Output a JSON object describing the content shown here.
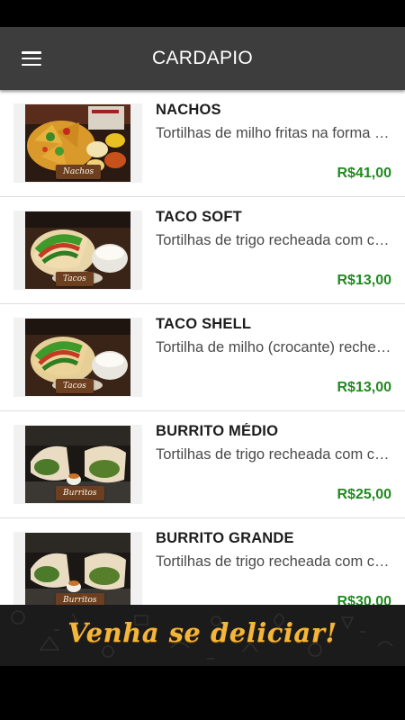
{
  "app_bar": {
    "title": "CARDAPIO",
    "menu_icon": "hamburger-menu-icon"
  },
  "colors": {
    "app_bar": "#3d3d3d",
    "price": "#1f8a1f",
    "banner_bg": "#1b1b1b",
    "banner_text": "#f4b63a"
  },
  "menu": {
    "items": [
      {
        "name": "NACHOS",
        "description": "Tortilhas de milho fritas na forma de triângulo",
        "price": "R$41,00",
        "tag": "Nachos",
        "photo": "nachos-photo"
      },
      {
        "name": "TACO SOFT",
        "description": "Tortilhas de trigo recheada com carne e salada",
        "price": "R$13,00",
        "tag": "Tacos",
        "photo": "taco-photo"
      },
      {
        "name": "TACO SHELL",
        "description": "Tortilha de milho (crocante) recheada",
        "price": "R$13,00",
        "tag": "Tacos",
        "photo": "taco-photo"
      },
      {
        "name": "BURRITO MÉDIO",
        "description": "Tortilhas de trigo recheada com carne e feijão",
        "price": "R$25,00",
        "tag": "Burritos",
        "photo": "burrito-photo"
      },
      {
        "name": "BURRITO GRANDE",
        "description": "Tortilhas de trigo recheada com carne e feijão",
        "price": "R$30,00",
        "tag": "Burritos",
        "photo": "burrito-photo"
      }
    ]
  },
  "banner": {
    "text": "Venha se deliciar!"
  }
}
